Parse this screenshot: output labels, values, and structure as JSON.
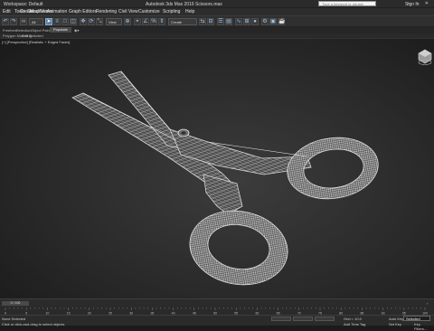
{
  "titlebar": {
    "workspace": "Workspace: Default",
    "title": "Autodesk 3ds Max 2016    Scissors.max",
    "search_placeholder": "Type a keyword or phrase",
    "signin": "Sign In",
    "controls": "– ▫ ✕"
  },
  "menu": [
    "Edit",
    "Tools",
    "Group",
    "Views",
    "Create",
    "Modifiers",
    "Animation",
    "Graph Editors",
    "Rendering",
    "Civil View",
    "Customize",
    "Scripting",
    "Help"
  ],
  "toolbar": {
    "all_filter": "All",
    "view_dropdown": "View",
    "selection_set": "Create Selection Se",
    "tools": [
      "undo-icon",
      "redo-icon",
      "link-icon",
      "unlink-icon",
      "bind-icon",
      "select-icon",
      "select-by-name-icon",
      "rect-region-icon",
      "window-crossing-icon",
      "move-icon",
      "rotate-icon",
      "scale-icon",
      "pivot-icon",
      "snap-icon",
      "angle-snap-icon",
      "percent-snap-icon",
      "spinner-snap-icon",
      "mirror-icon",
      "align-icon",
      "layer-icon",
      "scene-explorer-icon",
      "curve-editor-icon",
      "schematic-icon",
      "material-editor-icon",
      "render-setup-icon",
      "rendered-frame-icon",
      "render-icon"
    ]
  },
  "ribbon": {
    "tabs": [
      "Freeform",
      "Selection",
      "Object Paint",
      "Populate"
    ],
    "active": "Populate"
  },
  "subribbon": [
    "Polygon Modeling",
    "Edit Selected"
  ],
  "viewport": {
    "label": "[+] [Perspective] [Realistic + Edged Faces]"
  },
  "timeline": {
    "slider": "0 / 100",
    "ticks": [
      "0",
      "5",
      "10",
      "15",
      "20",
      "25",
      "30",
      "35",
      "40",
      "45",
      "50",
      "55",
      "60",
      "65",
      "70",
      "75",
      "80",
      "85",
      "90",
      "95",
      "100"
    ]
  },
  "status": {
    "selection": "None Selected",
    "prompt": "Click or click-and-drag to select objects",
    "grid": "Grid = 10.0",
    "add_time_tag": "Add Time Tag",
    "auto_key": "Auto Key",
    "set_key": "Set Key",
    "selected": "Selected",
    "key_filters": "Key Filters..."
  },
  "colors": {
    "viewport_center": "#3c3c3c",
    "wire": "#d0d0d0",
    "accent": "#5a7fa3"
  }
}
